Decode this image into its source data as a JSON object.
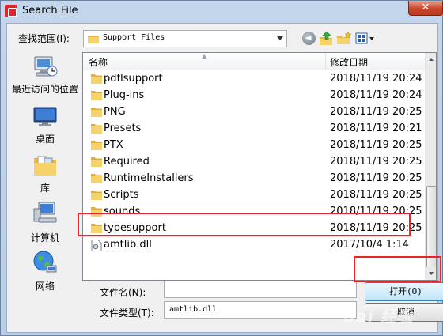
{
  "window": {
    "title": "Search File",
    "close_label": "✕"
  },
  "lookin": {
    "label": "查找范围(I):",
    "value": "Support Files"
  },
  "toolbar": {
    "back_icon": "back-icon",
    "up_icon": "up-folder-icon",
    "new_folder_icon": "new-folder-icon",
    "views_icon": "views-menu-icon"
  },
  "places": [
    {
      "label": "最近访问的位置",
      "icon": "recent-places-icon"
    },
    {
      "label": "桌面",
      "icon": "desktop-icon"
    },
    {
      "label": "库",
      "icon": "libraries-icon"
    },
    {
      "label": "计算机",
      "icon": "computer-icon"
    },
    {
      "label": "网络",
      "icon": "network-icon"
    }
  ],
  "list": {
    "columns": {
      "name": "名称",
      "date": "修改日期"
    },
    "rows": [
      {
        "name": "pdflsupport",
        "date": "2018/11/19 20:24",
        "type": "folder"
      },
      {
        "name": "Plug-ins",
        "date": "2018/11/19 20:24",
        "type": "folder"
      },
      {
        "name": "PNG",
        "date": "2018/11/19 20:25",
        "type": "folder"
      },
      {
        "name": "Presets",
        "date": "2018/11/19 20:21",
        "type": "folder"
      },
      {
        "name": "PTX",
        "date": "2018/11/19 20:25",
        "type": "folder"
      },
      {
        "name": "Required",
        "date": "2018/11/19 20:25",
        "type": "folder"
      },
      {
        "name": "RuntimeInstallers",
        "date": "2018/11/19 20:25",
        "type": "folder"
      },
      {
        "name": "Scripts",
        "date": "2018/11/19 20:25",
        "type": "folder"
      },
      {
        "name": "sounds",
        "date": "2018/11/19 20:25",
        "type": "folder"
      },
      {
        "name": "typesupport",
        "date": "2018/11/19 20:25",
        "type": "folder"
      },
      {
        "name": "amtlib.dll",
        "date": "2017/10/4 1:14",
        "type": "dll"
      }
    ]
  },
  "filename": {
    "label": "文件名(N):",
    "value": ""
  },
  "filetype": {
    "label": "文件类型(T):",
    "value": "amtlib.dll"
  },
  "buttons": {
    "open": "打开(O)",
    "cancel": "取消"
  },
  "watermark": "Bai 经验",
  "colors": {
    "highlight": "#e4252d",
    "folder": "#f2c55c"
  }
}
